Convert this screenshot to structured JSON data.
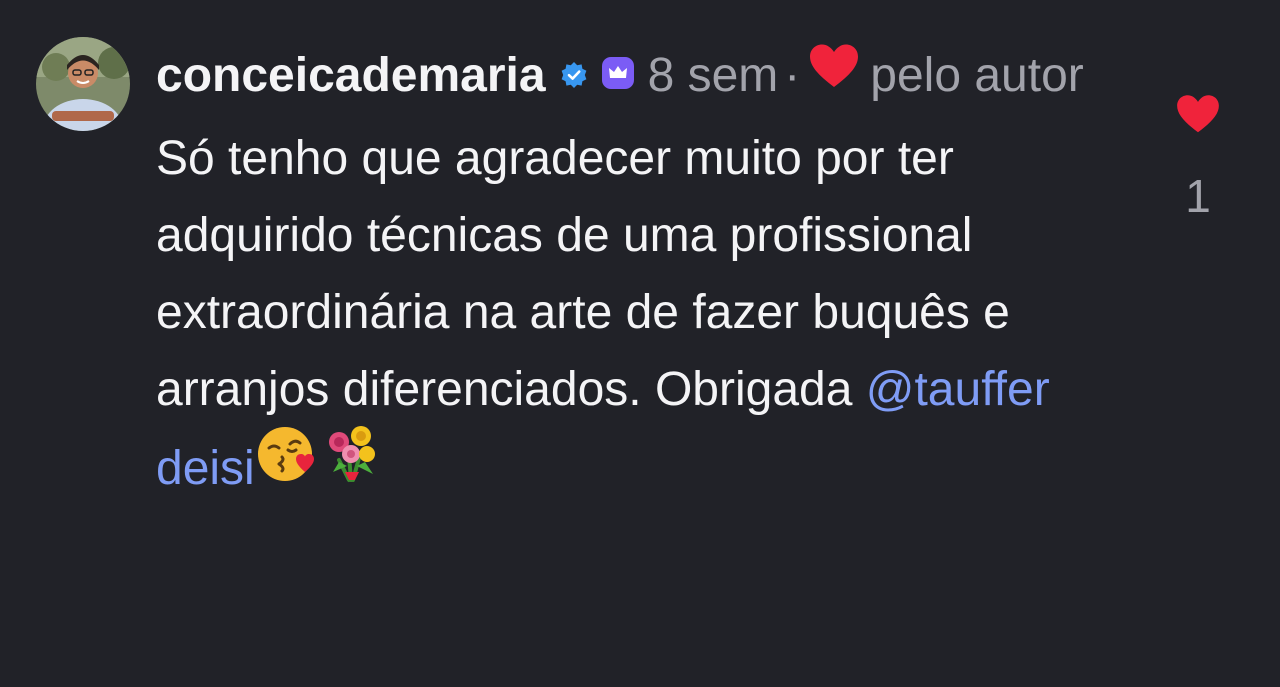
{
  "comment": {
    "username": "conceicademaria",
    "time": "8 sem",
    "separator": "·",
    "liked_by_text": "pelo autor",
    "text": "Só tenho que agradecer muito por ter adquirido técnicas de uma profissional extraordinária na arte de fazer buquês e arranjos diferenciados. Obrigada ",
    "mention": "@tauffer deisi",
    "emojis": [
      "face-blowing-kiss-emoji",
      "bouquet-emoji"
    ],
    "like_count": "1"
  },
  "icons": {
    "verified": "verified-badge-icon",
    "crown": "crown-badge-icon",
    "heart": "heart-icon"
  },
  "colors": {
    "background": "#212228",
    "text": "#f4f4f6",
    "muted": "#a2a3ab",
    "mention": "#7f9cf5",
    "heart": "#f0233b",
    "verified": "#3897f0",
    "crown_badge": "#7b5cf5"
  }
}
